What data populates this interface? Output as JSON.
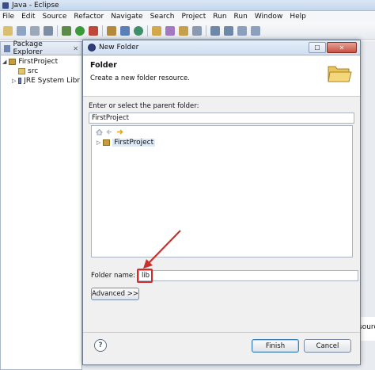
{
  "window": {
    "title": "Java - Eclipse",
    "menus": [
      "File",
      "Edit",
      "Source",
      "Refactor",
      "Navigate",
      "Search",
      "Project",
      "Run",
      "Run",
      "Window",
      "Help"
    ]
  },
  "explorer": {
    "tab_label": "Package Explorer",
    "close_glyph": "✕",
    "items": [
      {
        "label": "FirstProject"
      },
      {
        "label": "src"
      },
      {
        "label": "JRE System Libr"
      }
    ]
  },
  "side_fragment": "source",
  "dialog": {
    "title": "New Folder",
    "banner_title": "Folder",
    "banner_desc": "Create a new folder resource.",
    "parent_label": "Enter or select the parent folder:",
    "parent_value": "FirstProject",
    "tree_items": [
      {
        "label": "FirstProject"
      }
    ],
    "folder_name_label": "Folder name:",
    "folder_name_value": "lib",
    "advanced_label": "Advanced >>",
    "finish_label": "Finish",
    "cancel_label": "Cancel",
    "help_glyph": "?"
  },
  "colors": {
    "highlight_border": "#d32a2a",
    "arrow": "#c8312b"
  }
}
